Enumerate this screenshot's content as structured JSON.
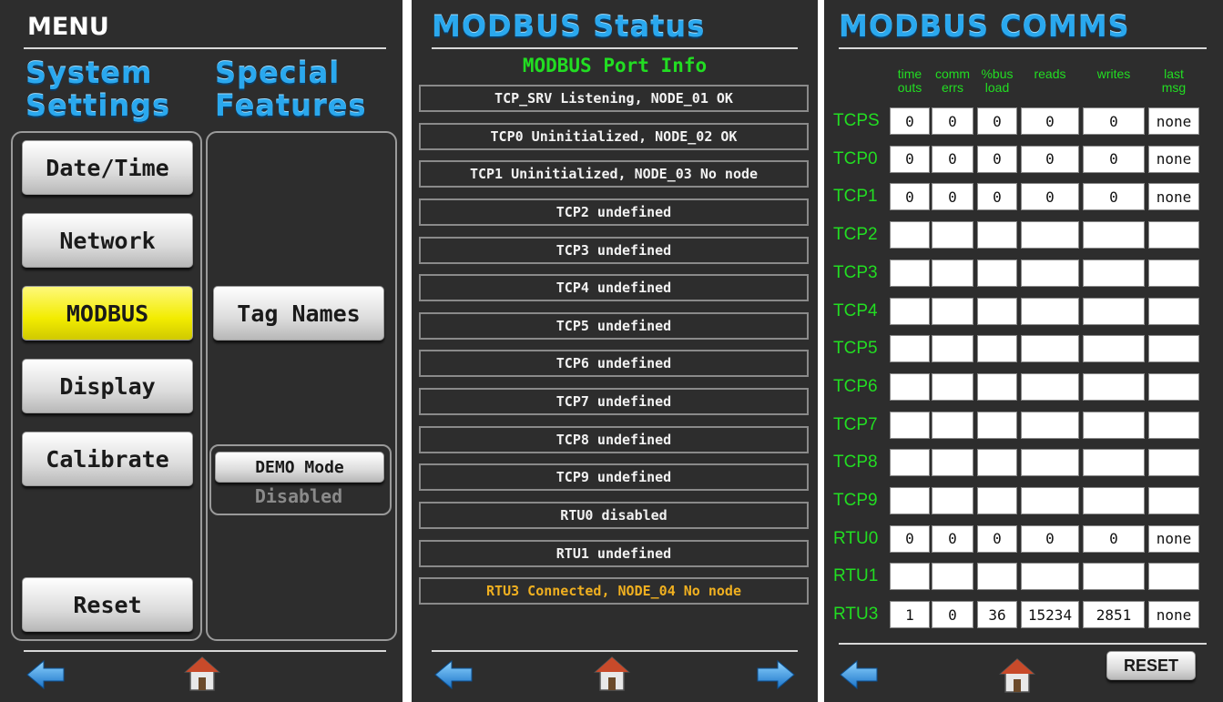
{
  "menu": {
    "title": "MENU",
    "system_settings": [
      "System",
      "Settings"
    ],
    "special_features": [
      "Special",
      "Features"
    ],
    "buttons": {
      "datetime": "Date/Time",
      "network": "Network",
      "modbus": "MODBUS",
      "display": "Display",
      "calibrate": "Calibrate",
      "reset": "Reset",
      "tag_names": "Tag Names",
      "demo_mode": "DEMO Mode"
    },
    "demo_status": "Disabled"
  },
  "status": {
    "title": "MODBUS Status",
    "subtitle": "MODBUS Port Info",
    "rows": [
      "TCP_SRV Listening, NODE_01 OK",
      "TCP0 Uninitialized, NODE_02 OK",
      "TCP1 Uninitialized, NODE_03 No node",
      "TCP2 undefined",
      "TCP3 undefined",
      "TCP4 undefined",
      "TCP5 undefined",
      "TCP6 undefined",
      "TCP7 undefined",
      "TCP8 undefined",
      "TCP9 undefined",
      "RTU0 disabled",
      "RTU1 undefined",
      "RTU3 Connected, NODE_04 No node"
    ]
  },
  "comms": {
    "title": "MODBUS COMMS",
    "columns": [
      [
        "time",
        "outs"
      ],
      [
        "comm",
        "errs"
      ],
      [
        "%bus",
        "load"
      ],
      [
        "",
        "reads"
      ],
      [
        "",
        "writes"
      ],
      [
        "last",
        "msg"
      ]
    ],
    "rows": [
      {
        "label": "TCPS",
        "values": [
          "0",
          "0",
          "0",
          "0",
          "0",
          "none"
        ]
      },
      {
        "label": "TCP0",
        "values": [
          "0",
          "0",
          "0",
          "0",
          "0",
          "none"
        ]
      },
      {
        "label": "TCP1",
        "values": [
          "0",
          "0",
          "0",
          "0",
          "0",
          "none"
        ]
      },
      {
        "label": "TCP2",
        "values": [
          "",
          "",
          "",
          "",
          "",
          ""
        ]
      },
      {
        "label": "TCP3",
        "values": [
          "",
          "",
          "",
          "",
          "",
          ""
        ]
      },
      {
        "label": "TCP4",
        "values": [
          "",
          "",
          "",
          "",
          "",
          ""
        ]
      },
      {
        "label": "TCP5",
        "values": [
          "",
          "",
          "",
          "",
          "",
          ""
        ]
      },
      {
        "label": "TCP6",
        "values": [
          "",
          "",
          "",
          "",
          "",
          ""
        ]
      },
      {
        "label": "TCP7",
        "values": [
          "",
          "",
          "",
          "",
          "",
          ""
        ]
      },
      {
        "label": "TCP8",
        "values": [
          "",
          "",
          "",
          "",
          "",
          ""
        ]
      },
      {
        "label": "TCP9",
        "values": [
          "",
          "",
          "",
          "",
          "",
          ""
        ]
      },
      {
        "label": "RTU0",
        "values": [
          "0",
          "0",
          "0",
          "0",
          "0",
          "none"
        ]
      },
      {
        "label": "RTU1",
        "values": [
          "",
          "",
          "",
          "",
          "",
          ""
        ]
      },
      {
        "label": "RTU3",
        "values": [
          "1",
          "0",
          "36",
          "15234",
          "2851",
          "none"
        ]
      }
    ],
    "reset_label": "RESET"
  },
  "colors": {
    "panel_bg": "#2d2d2d",
    "title_blue": "#2aa8ee",
    "label_green": "#22dd22",
    "active_yellow": "#f2ec00",
    "warn_orange": "#f0b020"
  },
  "icons": [
    "back-arrow-icon",
    "home-icon",
    "forward-arrow-icon"
  ]
}
